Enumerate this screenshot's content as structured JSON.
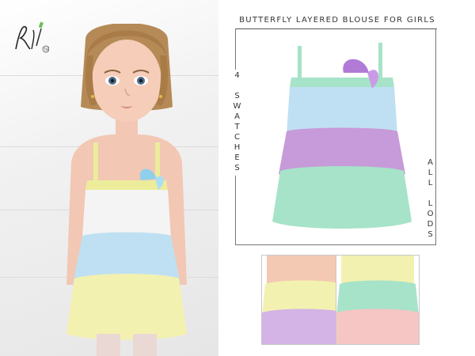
{
  "product": {
    "title": "BUTTERFLY LAYERED BLOUSE FOR GIRLS",
    "swatches_label": "4 SWATCHES",
    "lods_label": "ALL LODS",
    "logo_text": "RpL TSR"
  },
  "colors": {
    "blue": "#bfe0f2",
    "purple": "#c79ad9",
    "mint": "#a6e3c8",
    "yellow": "#f3f1b0",
    "peach": "#f4c9b3",
    "pink": "#f6c6c4",
    "white": "#f4f4f4",
    "lavender": "#d4b3e6",
    "butterfly_blue": "#8fd0ec",
    "butterfly_purple": "#b07ad6"
  },
  "icons": {
    "butterfly": "butterfly-icon",
    "logo": "signature-logo"
  }
}
